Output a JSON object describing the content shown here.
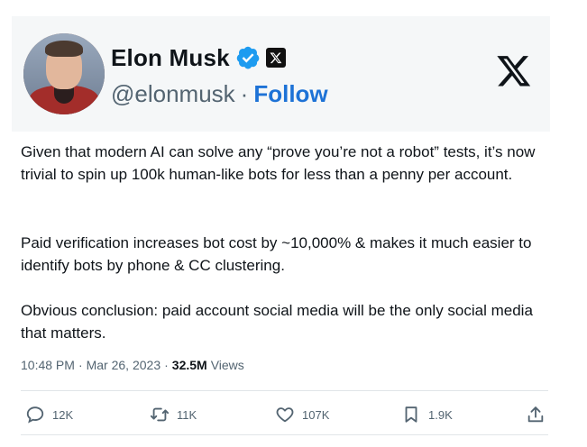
{
  "author": {
    "name": "Elon Musk",
    "handle": "@elonmusk",
    "separator": "·",
    "follow_label": "Follow"
  },
  "tweet": {
    "paragraphs": [
      "Given that modern AI can solve any “prove you’re not a robot” tests, it’s now trivial to spin up 100k human-like bots for less than a penny per account.",
      "Paid verification increases bot cost by ~10,000% & makes it much easier to identify bots by phone & CC clustering.",
      "Obvious conclusion: paid account social media will be the only social media that matters."
    ]
  },
  "meta": {
    "time": "10:48 PM",
    "separator": "·",
    "date": "Mar 26, 2023",
    "separator2": "·",
    "views_count": "32.5M",
    "views_label": "Views"
  },
  "actions": {
    "replies": "12K",
    "retweets": "11K",
    "likes": "107K",
    "bookmarks": "1.9K"
  },
  "icons": {
    "verified": "verified-badge-icon",
    "affiliate": "x-affiliate-badge-icon",
    "logo": "x-logo-icon",
    "reply": "reply-icon",
    "retweet": "retweet-icon",
    "like": "heart-icon",
    "bookmark": "bookmark-icon",
    "share": "share-icon"
  },
  "colors": {
    "verified": "#1d9bf0",
    "follow": "#1d72d6",
    "secondary_text": "#536471"
  }
}
